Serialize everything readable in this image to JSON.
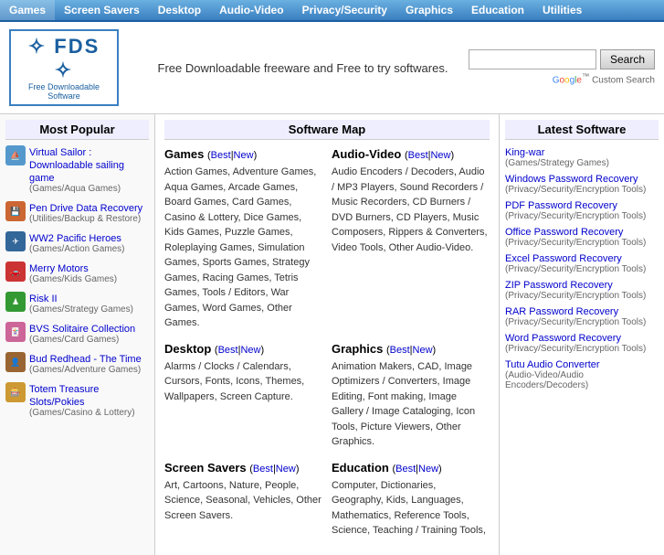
{
  "topnav": {
    "items": [
      {
        "label": "Games",
        "href": "#"
      },
      {
        "label": "Screen Savers",
        "href": "#"
      },
      {
        "label": "Desktop",
        "href": "#"
      },
      {
        "label": "Audio-Video",
        "href": "#"
      },
      {
        "label": "Privacy/Security",
        "href": "#"
      },
      {
        "label": "Graphics",
        "href": "#"
      },
      {
        "label": "Education",
        "href": "#"
      },
      {
        "label": "Utilities",
        "href": "#"
      }
    ]
  },
  "header": {
    "logo_main": "✧ FDS ✧",
    "logo_sub": "Free Downloadable Software",
    "tagline": "Free Downloadable freeware and Free to try softwares.",
    "search_placeholder": "",
    "search_btn": "Search",
    "google_label": "Google™ Custom Search"
  },
  "most_popular": {
    "title": "Most Popular",
    "items": [
      {
        "name": "Virtual Sailor : Downloadable sailing game",
        "category": "(Games/Aqua Games)",
        "icon": "⛵",
        "icon_type": "ship"
      },
      {
        "name": "Pen Drive Data Recovery",
        "category": "(Utilities/Backup & Restore)",
        "icon": "💾",
        "icon_type": "pen"
      },
      {
        "name": "WW2 Pacific Heroes",
        "category": "(Games/Action Games)",
        "icon": "✈",
        "icon_type": "ww2"
      },
      {
        "name": "Merry Motors",
        "category": "(Games/Kids Games)",
        "icon": "🚗",
        "icon_type": "car"
      },
      {
        "name": "Risk II",
        "category": "(Games/Strategy Games)",
        "icon": "♟",
        "icon_type": "card"
      },
      {
        "name": "BVS Solitaire Collection",
        "category": "(Games/Card Games)",
        "icon": "🃏",
        "icon_type": "solitaire"
      },
      {
        "name": "Bud Redhead - The Time",
        "category": "(Games/Adventure Games)",
        "icon": "👤",
        "icon_type": "game"
      },
      {
        "name": "Totem Treasure Slots/Pokies",
        "category": "(Games/Casino & Lottery)",
        "icon": "🎰",
        "icon_type": "treasure"
      }
    ]
  },
  "software_map": {
    "title": "Software Map",
    "sections": [
      {
        "id": "games",
        "title": "Games",
        "best_label": "Best",
        "new_label": "New",
        "content": "Action Games, Adventure Games, Aqua Games, Arcade Games, Board Games, Card Games, Casino & Lottery, Dice Games, Kids Games, Puzzle Games, Roleplaying Games, Simulation Games, Sports Games, Strategy Games, Racing Games, Tetris Games, Tools / Editors, War Games, Word Games, Other Games."
      },
      {
        "id": "audio-video",
        "title": "Audio-Video",
        "best_label": "Best",
        "new_label": "New",
        "content": "Audio Encoders / Decoders, Audio / MP3 Players, Sound Recorders / Music Recorders, CD Burners / DVD Burners, CD Players, Music Composers, Rippers & Converters, Video Tools, Other Audio-Video."
      },
      {
        "id": "desktop",
        "title": "Desktop",
        "best_label": "Best",
        "new_label": "New",
        "content": "Alarms / Clocks / Calendars, Cursors, Fonts, Icons, Themes, Wallpapers, Screen Capture."
      },
      {
        "id": "graphics",
        "title": "Graphics",
        "best_label": "Best",
        "new_label": "New",
        "content": "Animation Makers, CAD, Image Optimizers / Converters, Image Editing, Font making, Image Gallery / Image Cataloging, Icon Tools, Picture Viewers, Other Graphics."
      },
      {
        "id": "screensavers",
        "title": "Screen Savers",
        "best_label": "Best",
        "new_label": "New",
        "content": "Art, Cartoons, Nature, People, Science, Seasonal, Vehicles, Other Screen Savers."
      },
      {
        "id": "education",
        "title": "Education",
        "best_label": "Best",
        "new_label": "New",
        "content": "Computer, Dictionaries, Geography, Kids, Languages, Mathematics, Reference Tools, Science, Teaching / Training Tools,"
      }
    ]
  },
  "latest_software": {
    "title": "Latest Software",
    "items": [
      {
        "name": "King-war",
        "category": "(Games/Strategy Games)"
      },
      {
        "name": "Windows Password Recovery",
        "category": "(Privacy/Security/Encryption Tools)"
      },
      {
        "name": "PDF Password Recovery",
        "category": "(Privacy/Security/Encryption Tools)"
      },
      {
        "name": "Office Password Recovery",
        "category": "(Privacy/Security/Encryption Tools)"
      },
      {
        "name": "Excel Password Recovery",
        "category": "(Privacy/Security/Encryption Tools)"
      },
      {
        "name": "ZIP Password Recovery",
        "category": "(Privacy/Security/Encryption Tools)"
      },
      {
        "name": "RAR Password Recovery",
        "category": "(Privacy/Security/Encryption Tools)"
      },
      {
        "name": "Word Password Recovery",
        "category": "(Privacy/Security/Encryption Tools)"
      },
      {
        "name": "Tutu Audio Converter",
        "category": "(Audio-Video/Audio Encoders/Decoders)"
      }
    ]
  }
}
